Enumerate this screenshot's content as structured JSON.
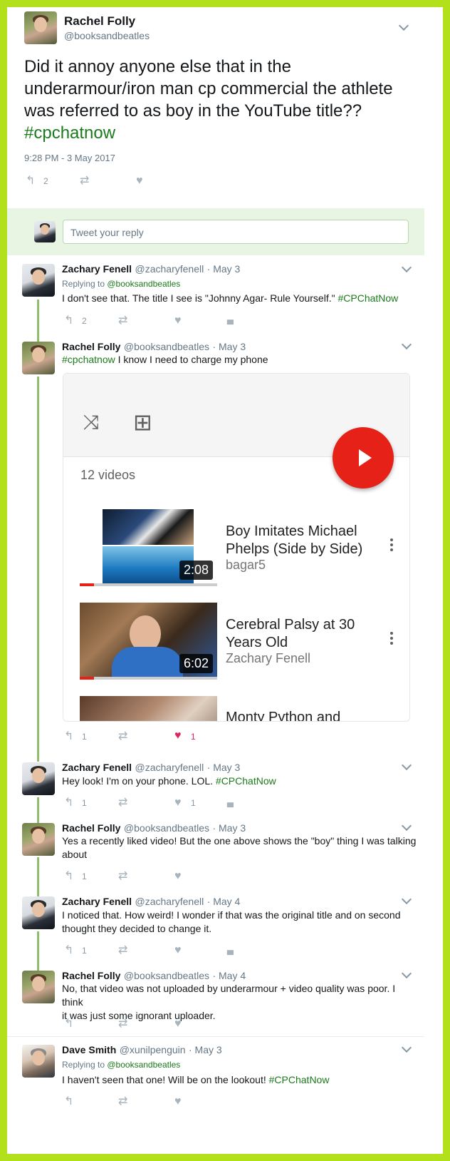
{
  "main_tweet": {
    "name": "Rachel Folly",
    "handle": "@booksandbeatles",
    "text": "Did it annoy anyone else that in the underarmour/iron man cp commercial the athlete was referred to as boy in the YouTube title?? ",
    "hashtag": "#cpchatnow",
    "timestamp": "9:28 PM - 3 May 2017",
    "reply_count": "2"
  },
  "reply_box": {
    "placeholder": "Tweet your reply"
  },
  "replies": [
    {
      "name": "Zachary Fenell",
      "handle": "@zacharyfenell",
      "date": "· May 3",
      "replying_label": "Replying to ",
      "replying_to": "@booksandbeatles",
      "text": "I don't see that. The title I see is \"Johnny Agar- Rule Yourself.\" ",
      "hashtag": "#CPChatNow",
      "reply_count": "2"
    },
    {
      "name": "Rachel Folly",
      "handle": "@booksandbeatles",
      "date": "· May 3",
      "hashtag": "#cpchatnow",
      "text": " I know I need to charge my phone",
      "reply_count": "1",
      "like_count": "1"
    },
    {
      "name": "Zachary Fenell",
      "handle": "@zacharyfenell",
      "date": "· May 3",
      "text": "Hey look! I'm on your phone. LOL. ",
      "hashtag": "#CPChatNow",
      "reply_count": "1",
      "like_count": "1"
    },
    {
      "name": "Rachel Folly",
      "handle": "@booksandbeatles",
      "date": "· May 3",
      "text_line1": "Yes a recently liked video! But the one above shows the \"boy\" thing I was talking",
      "text_line2": "about",
      "reply_count": "1"
    },
    {
      "name": "Zachary Fenell",
      "handle": "@zacharyfenell",
      "date": "· May 4",
      "text_line1": "I noticed that. How weird! I wonder if that was the original title and on second",
      "text_line2": "thought they decided to change it.",
      "reply_count": "1"
    },
    {
      "name": "Rachel Folly",
      "handle": "@booksandbeatles",
      "date": "· May 4",
      "text_line1": "No, that video was not uploaded by underarmour + video quality was poor. I think",
      "text_line2": "it was just some ignorant uploader."
    },
    {
      "name": "Dave Smith",
      "handle": "@xunilpenguin",
      "date": "· May 3",
      "replying_label": "Replying to ",
      "replying_to": "@booksandbeatles",
      "text": "I haven't seen that one! Will be on the lookout! ",
      "hashtag": "#CPChatNow"
    }
  ],
  "playlist": {
    "count_label": "12 videos",
    "videos": [
      {
        "title_line1": "Boy Imitates Michael",
        "title_line2": "Phelps (Side by Side)",
        "author": "bagar5",
        "duration": "2:08"
      },
      {
        "title_line1": "Cerebral Palsy at 30",
        "title_line2": "Years Old",
        "author": "Zachary Fenell",
        "duration": "6:02"
      },
      {
        "title_line1": "Monty Python and"
      }
    ]
  },
  "icons": {
    "reply": "↰",
    "retweet": "⇄",
    "like": "♥",
    "analytics": "▮▮▮",
    "shuffle": "⤨",
    "add_to_playlist": "⊞"
  },
  "colors": {
    "frame": "#b2e01b",
    "hashtag": "#1b7a1b",
    "like_active": "#e0245e",
    "play": "#e62117"
  }
}
